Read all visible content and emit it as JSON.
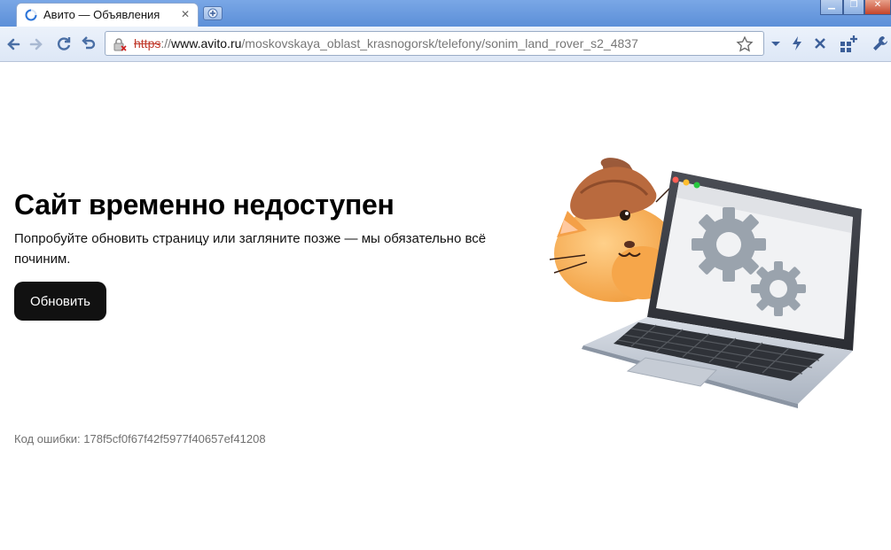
{
  "browser": {
    "tab": {
      "title": "Авито — Объявления"
    },
    "address_bar": {
      "scheme": "https",
      "separator": "://",
      "host": "www.avito.ru",
      "path": "/moskovskaya_oblast_krasnogorsk/telefony/sonim_land_rover_s2_4837"
    },
    "icons": {
      "back": "back-arrow-icon",
      "forward": "forward-arrow-icon",
      "reload": "reload-icon",
      "undo": "undo-icon",
      "security": "broken-lock-icon",
      "bookmark": "star-icon",
      "dropdown": "chevron-down-icon",
      "action": "lightning-icon",
      "stop": "close-icon",
      "extensions": "blocks-plus-icon",
      "settings": "wrench-icon"
    }
  },
  "page": {
    "title": "Сайт временно недоступен",
    "description": "Попробуйте обновить страницу или загляните позже — мы обязательно всё починим.",
    "button_label": "Обновить",
    "error_code": "Код ошибки: 178f5cf0f67f42f5977f40657ef41208"
  },
  "colors": {
    "button_bg": "#111111",
    "error_text": "#707070",
    "titlebar": "#6a9ae0"
  }
}
